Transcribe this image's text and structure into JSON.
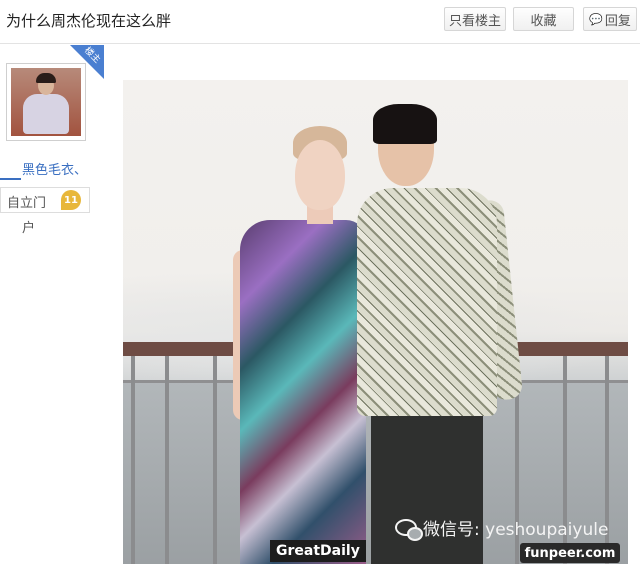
{
  "header": {
    "thread_title": "为什么周杰伦现在这么胖",
    "only_op_label": "只看楼主",
    "favorite_label": "收藏",
    "reply_label": "回复"
  },
  "sidebar": {
    "badge_label": "楼主",
    "username": "黑色毛衣、",
    "level_name": "自立门",
    "level_number": "11",
    "level_name_tail": "户"
  },
  "watermarks": {
    "wechat_text": "微信号: yeshoupaiyule",
    "greatdaily": "GreatDaily",
    "funpeer": "funpeer.com"
  },
  "colors": {
    "accent_blue": "#3a6fc1",
    "badge_blue": "#4a7fd1",
    "level_gold": "#e8b73a"
  }
}
